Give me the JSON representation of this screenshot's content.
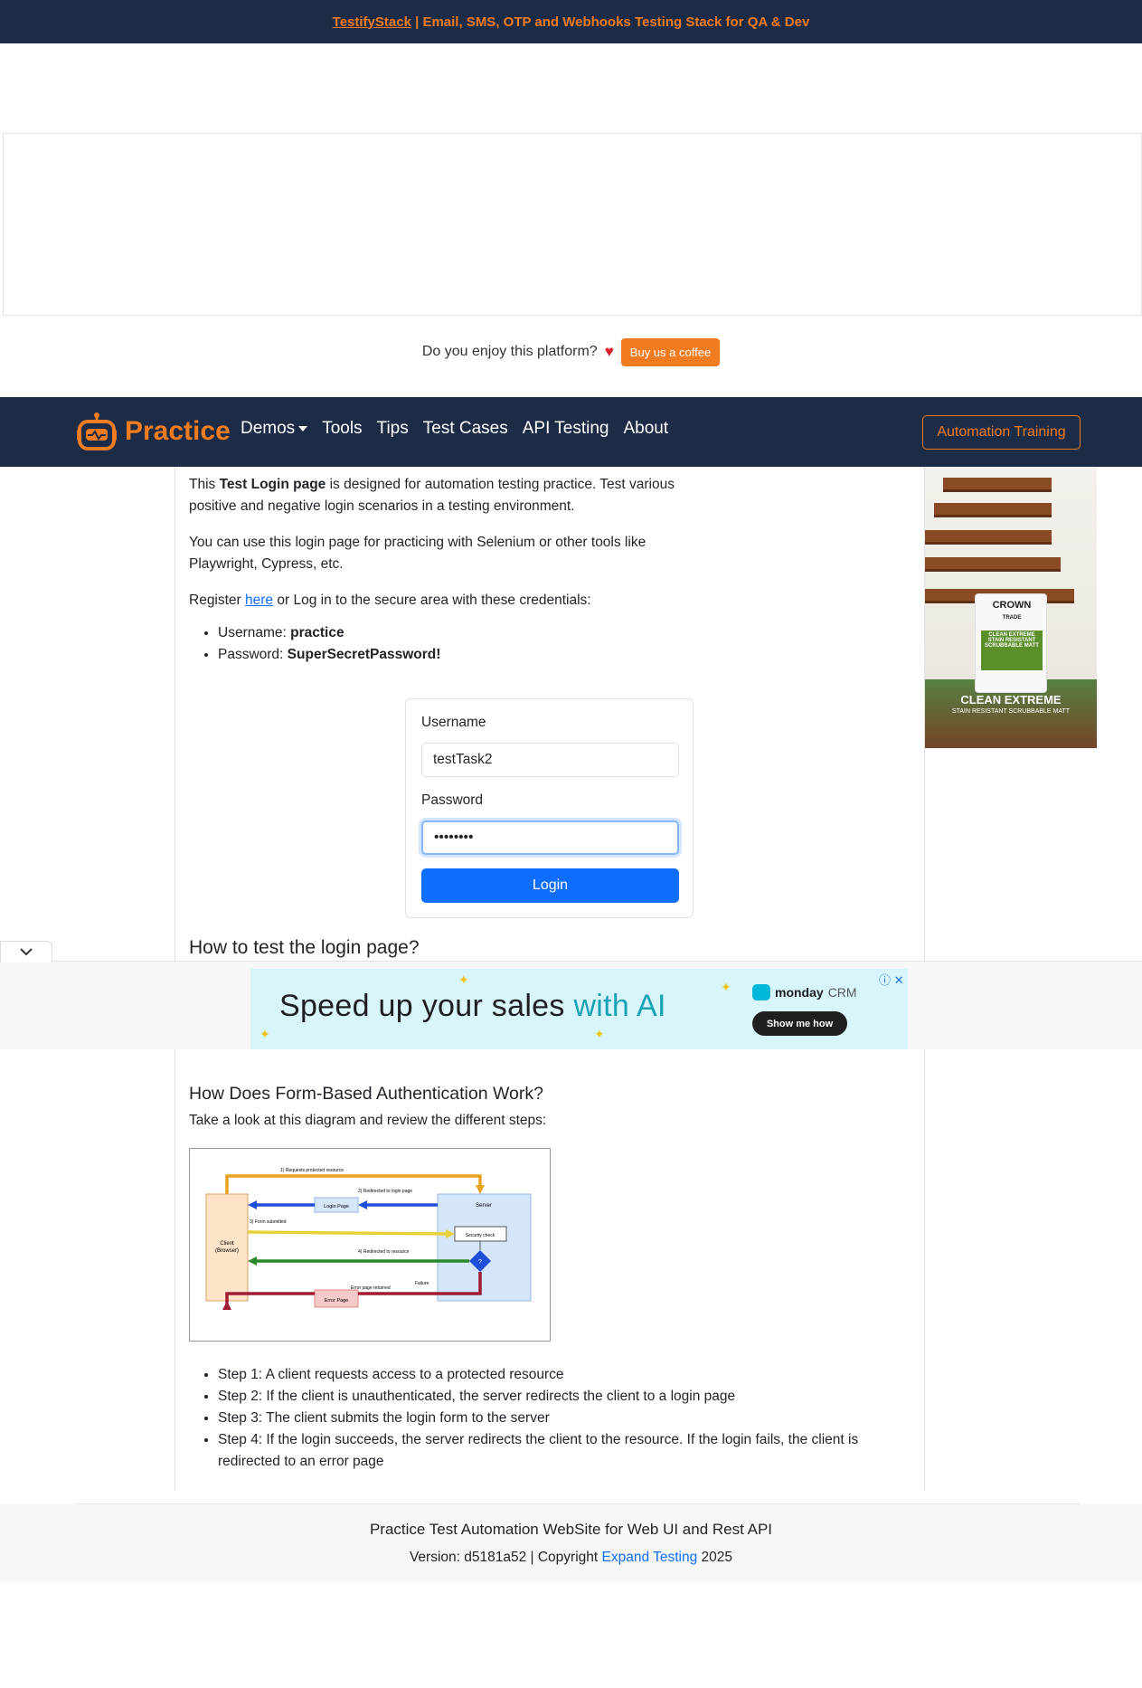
{
  "top_banner": {
    "brand_link": "TestifyStack",
    "text": " | Email, SMS, OTP and Webhooks Testing Stack for QA & Dev"
  },
  "coffee": {
    "question": "Do you enjoy this platform?",
    "button": "Buy us a coffee"
  },
  "navbar": {
    "brand": "Practice",
    "links": [
      "Demos",
      "Tools",
      "Tips",
      "Test Cases",
      "API Testing",
      "About"
    ],
    "training_button": "Automation Training"
  },
  "intro": {
    "p1_pre": "This ",
    "p1_bold": "Test Login page",
    "p1_post": " is designed for automation testing practice. Test various positive and negative login scenarios in a testing environment.",
    "p2": "You can use this login page for practicing with Selenium or other tools like Playwright, Cypress, etc.",
    "p3_pre": "Register ",
    "p3_link": "here",
    "p3_post": " or Log in to the secure area with these credentials:",
    "username_label": "Username: ",
    "username_value": "practice",
    "password_label": "Password: ",
    "password_value": "SuperSecretPassword!"
  },
  "login_form": {
    "username_label": "Username",
    "username_value": "testTask2",
    "password_label": "Password",
    "password_value": "••••••••",
    "submit": "Login"
  },
  "section_headings": {
    "how_to_test": "How to test the login page?",
    "how_auth_works": "How Does Form-Based Authentication Work?",
    "diagram_intro": "Take a look at this diagram and review the different steps:"
  },
  "sticky_ad": {
    "headline_pre": "Speed up your sales ",
    "headline_ai": "with AI",
    "brand": "monday",
    "brand_suffix": "CRM",
    "cta": "Show me how"
  },
  "side_ad": {
    "brand": "CROWN",
    "brand_sub": "TRADE",
    "can_label": "CLEAN EXTREME STAIN RESISTANT SCRUBBABLE MATT",
    "title": "CLEAN EXTREME",
    "subtitle": "STAIN RESISTANT SCRUBBABLE MATT"
  },
  "diagram": {
    "labels": {
      "step1": "1) Requests protected resource",
      "step2": "2) Redirected to login page",
      "step3": "3) Form submitted",
      "step4": "4) Redirected to resource",
      "client": "Client",
      "client_sub": "(Browser)",
      "login_page": "Login Page",
      "server": "Server",
      "security_check": "Security check",
      "decision": "?",
      "error_page": "Error Page",
      "error_returned": "Error page returned",
      "failure": "Failure"
    },
    "colors": {
      "request": "#e8a020",
      "redirect_login": "#1f4fd8",
      "form_submit": "#e8d23a",
      "redirect_resource": "#2a8a2a",
      "error": "#a01c35"
    }
  },
  "steps": [
    "Step 1: A client requests access to a protected resource",
    "Step 2: If the client is unauthenticated, the server redirects the client to a login page",
    "Step 3: The client submits the login form to the server",
    "Step 4: If the login succeeds, the server redirects the client to the resource. If the login fails, the client is redirected to an error page"
  ],
  "footer": {
    "title": "Practice Test Automation WebSite for Web UI and Rest API",
    "version_pre": "Version: d5181a52 | Copyright ",
    "version_link": "Expand Testing",
    "version_post": " 2025"
  },
  "colors": {
    "navy": "#1c2b46",
    "accent_orange": "#f07c1f",
    "primary_blue": "#0d6efd"
  }
}
